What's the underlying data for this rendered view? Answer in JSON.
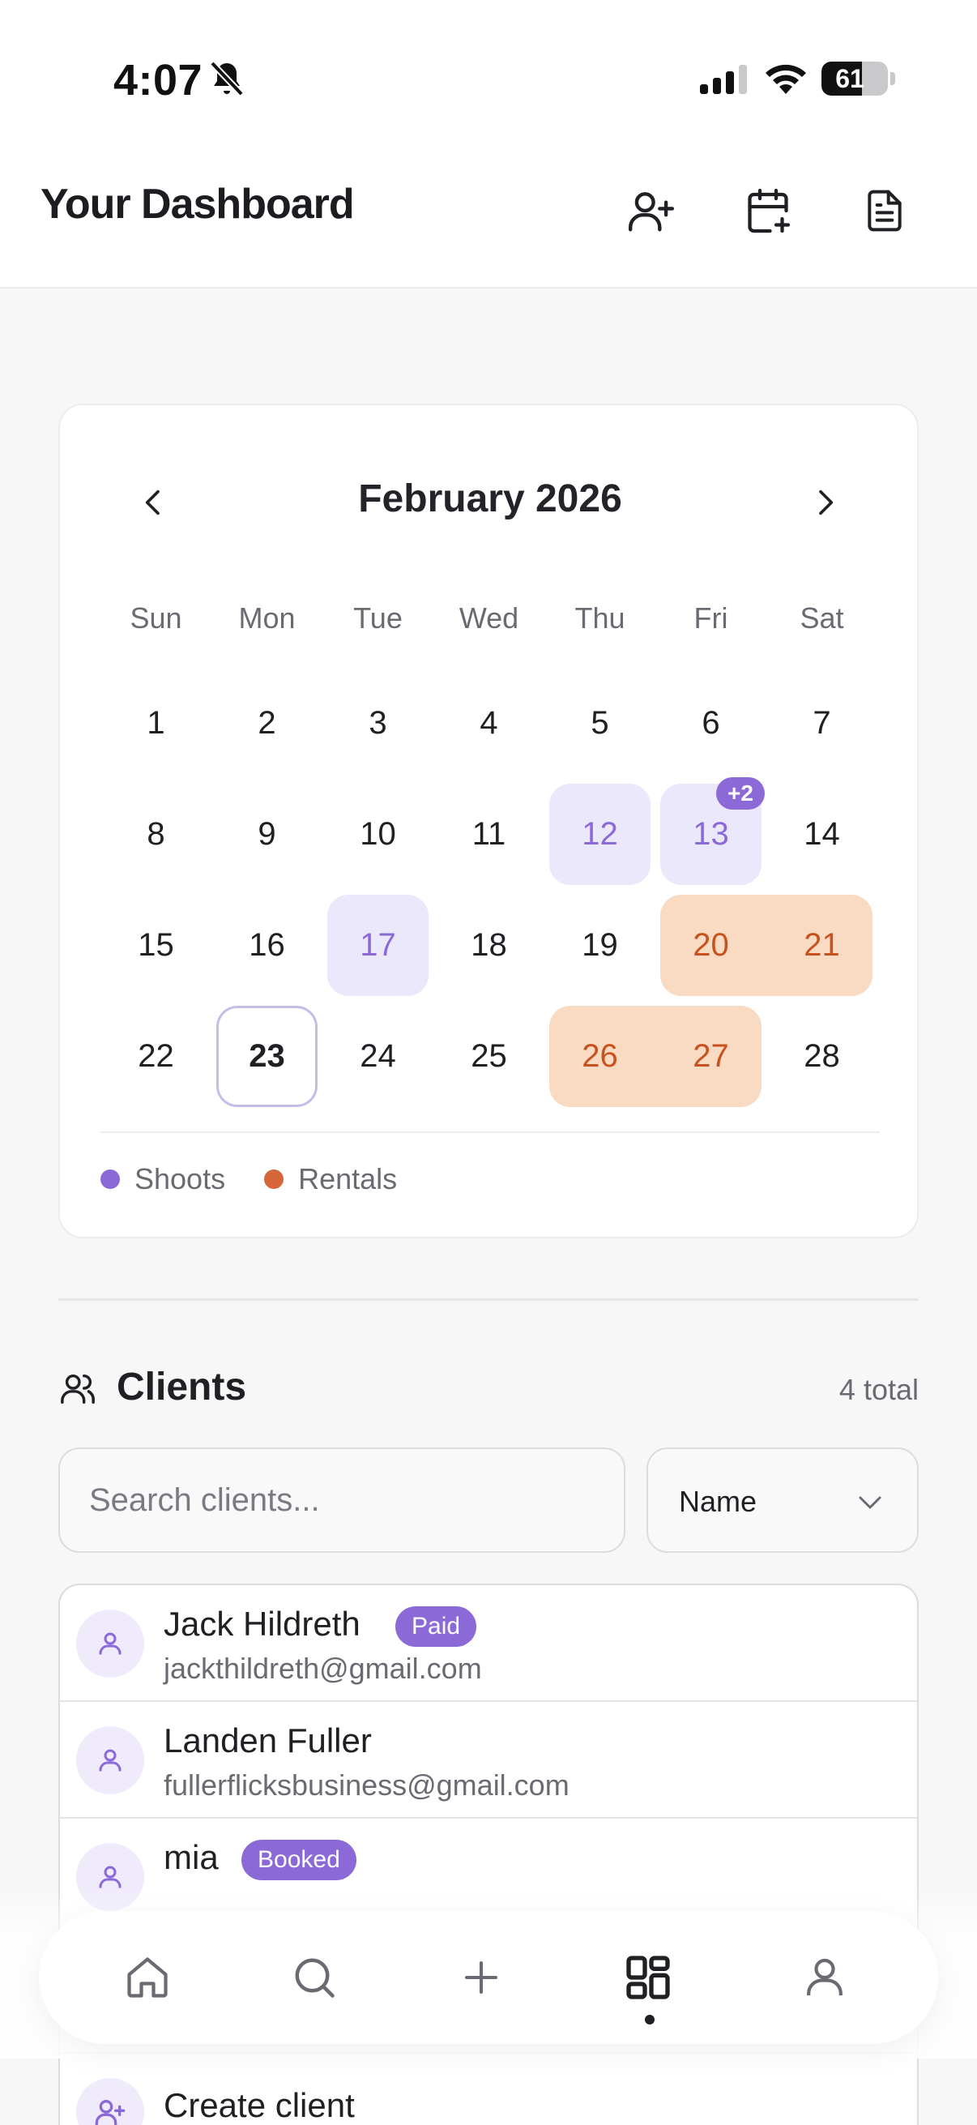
{
  "status_bar": {
    "time": "4:07",
    "battery": "61",
    "battery_level": 0.61
  },
  "header": {
    "title": "Your Dashboard",
    "actions": [
      "add-user-icon",
      "calendar-plus-icon",
      "document-icon"
    ]
  },
  "calendar": {
    "month_label": "February 2026",
    "weekdays": [
      "Sun",
      "Mon",
      "Tue",
      "Wed",
      "Thu",
      "Fri",
      "Sat"
    ],
    "first_weekday": 0,
    "days_in_month": 28,
    "today": 23,
    "shoot_days": [
      12,
      13,
      17
    ],
    "rental_ranges": [
      [
        20,
        21
      ],
      [
        26,
        27
      ]
    ],
    "more_badge": {
      "day": 13,
      "label": "+2"
    },
    "legend": [
      {
        "label": "Shoots",
        "color": "#8b6ad8"
      },
      {
        "label": "Rentals",
        "color": "#d4663a"
      }
    ]
  },
  "clients": {
    "title": "Clients",
    "total": "4 total",
    "search_placeholder": "Search clients...",
    "sort_value": "Name",
    "items": [
      {
        "name": "Jack Hildreth",
        "email": "jackthildreth@gmail.com",
        "badge": "Paid"
      },
      {
        "name": "Landen Fuller",
        "email": "fullerflicksbusiness@gmail.com",
        "badge": ""
      },
      {
        "name": "mia",
        "email": "",
        "badge": "Booked"
      }
    ],
    "create_label": "Create client"
  },
  "bottom_nav": {
    "items": [
      "home-icon",
      "search-icon",
      "plus-icon",
      "dashboard-icon",
      "profile-icon"
    ],
    "active": "dashboard-icon"
  },
  "colors": {
    "accent": "#8b6ad8",
    "shoot_bg": "#ece8fb",
    "rental_bg": "#f9dac3",
    "rental_text": "#c8521e"
  }
}
